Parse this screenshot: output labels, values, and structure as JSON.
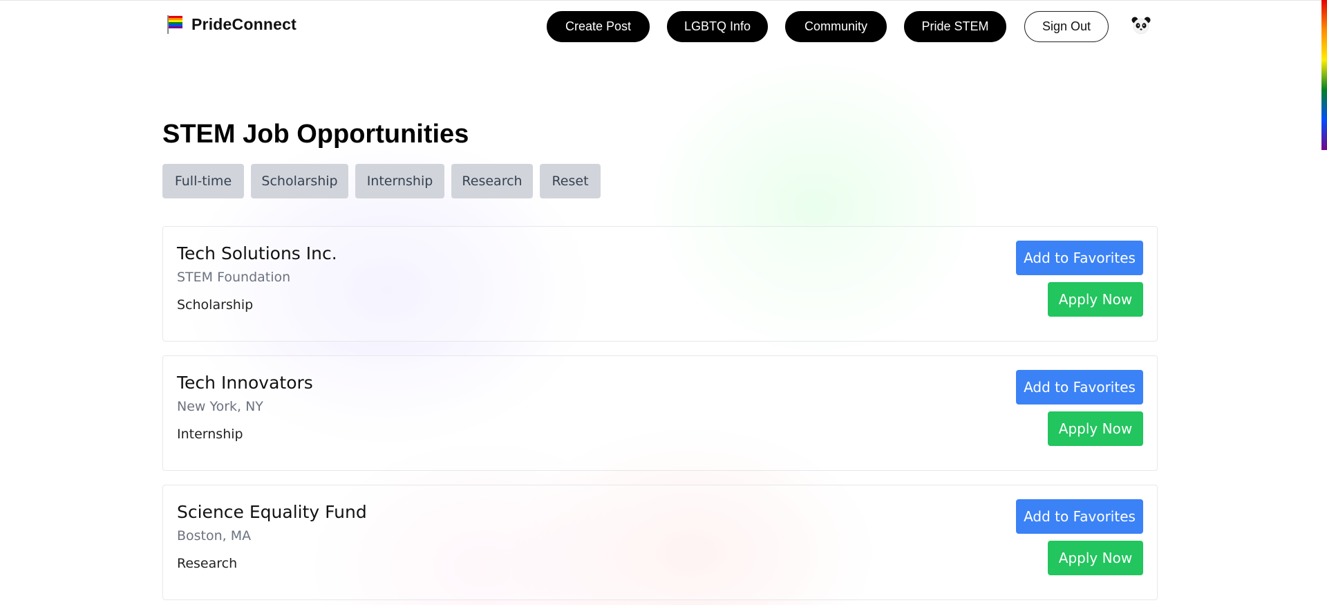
{
  "app": {
    "name": "PrideConnect",
    "logo_icon": "rainbow-flag-icon",
    "rainbow_colors": [
      "#e40303",
      "#ff8c00",
      "#ffed00",
      "#008026",
      "#004dff",
      "#750787"
    ]
  },
  "nav": {
    "create_post": "Create Post",
    "lgbtq_info": "LGBTQ Info",
    "community": "Community",
    "pride_stem": "Pride STEM",
    "sign_out": "Sign Out",
    "avatar_icon": "panda-avatar-icon"
  },
  "page": {
    "title": "STEM Job Opportunities"
  },
  "filters": [
    "Full-time",
    "Scholarship",
    "Internship",
    "Research",
    "Reset"
  ],
  "jobs": [
    {
      "title": "Tech Solutions Inc.",
      "subtitle": "STEM Foundation",
      "type": "Scholarship",
      "favorite_label": "Add to Favorites",
      "apply_label": "Apply Now"
    },
    {
      "title": "Tech Innovators",
      "subtitle": "New York, NY",
      "type": "Internship",
      "favorite_label": "Add to Favorites",
      "apply_label": "Apply Now"
    },
    {
      "title": "Science Equality Fund",
      "subtitle": "Boston, MA",
      "type": "Research",
      "favorite_label": "Add to Favorites",
      "apply_label": "Apply Now"
    }
  ],
  "colors": {
    "favorite_button": "#3b82f6",
    "apply_button": "#22c55e",
    "filter_button": "#d1d5db",
    "nav_button": "#000000"
  }
}
